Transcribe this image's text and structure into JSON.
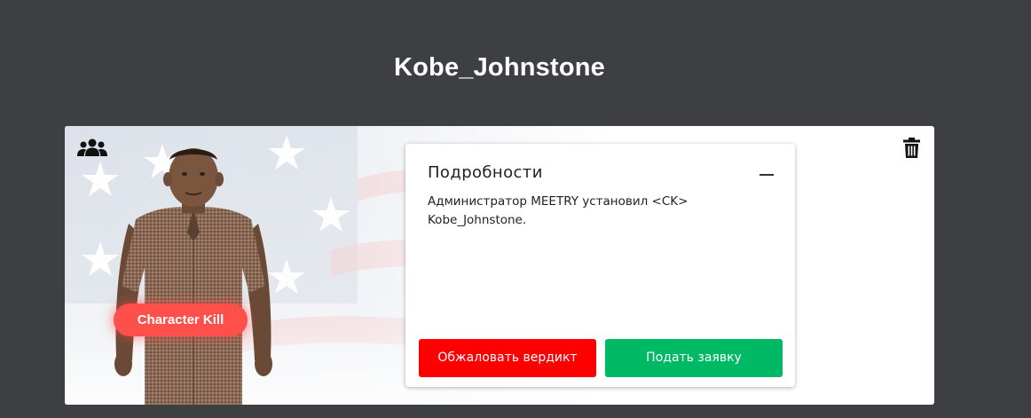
{
  "page": {
    "title": "Kobe_Johnstone"
  },
  "card": {
    "badge_label": "Character Kill",
    "group_icon": "users-group-icon",
    "trash_icon": "trash-icon"
  },
  "details": {
    "title": "Подробности",
    "collapse_icon": "minus-icon",
    "text": "Администратор MEETRY установил <CK> Kobe_Johnstone.",
    "appeal_button": "Обжаловать вердикт",
    "apply_button": "Подать заявку"
  },
  "colors": {
    "background": "#3e3f42",
    "badge": "#ff4f4a",
    "appeal": "#ff0000",
    "apply": "#00b964"
  }
}
